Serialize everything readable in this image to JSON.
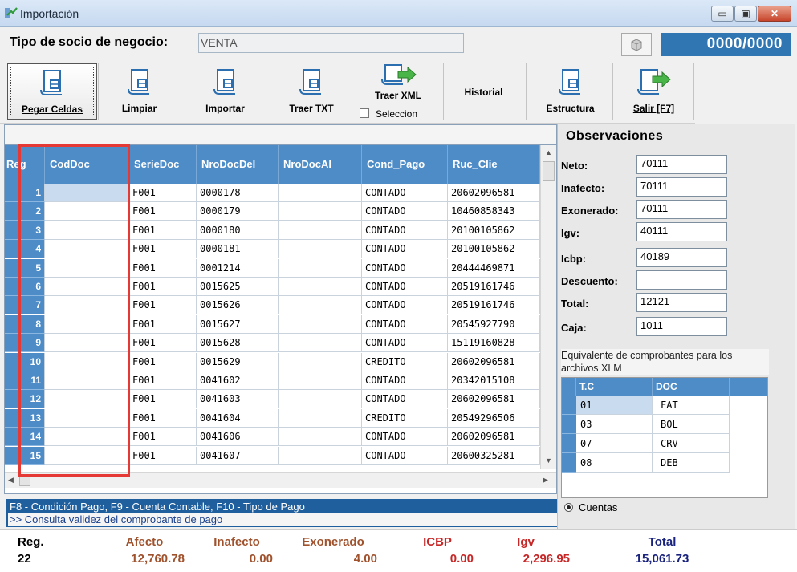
{
  "window": {
    "title": "Importación",
    "min_glyph": "▭",
    "max_glyph": "▣",
    "close_glyph": "✕"
  },
  "partner": {
    "label": "Tipo de socio de negocio:",
    "value": "VENTA",
    "counter": "0000/0000"
  },
  "toolbar": {
    "pegar": "Pegar Celdas",
    "limpiar": "Limpiar",
    "importar": "Importar",
    "traer_txt": "Traer TXT",
    "traer_xml": "Traer XML",
    "seleccion": "Seleccion",
    "historial": "Historial",
    "estructura": "Estructura",
    "salir": "Salir [F7]"
  },
  "grid": {
    "columns": [
      "Reg",
      "CodDoc",
      "SerieDoc",
      "NroDocDel",
      "NroDocAl",
      "Cond_Pago",
      "Ruc_Clie"
    ],
    "rows": [
      [
        "1",
        "",
        "F001",
        "0000178",
        "",
        "CONTADO",
        "20602096581"
      ],
      [
        "2",
        "",
        "F001",
        "0000179",
        "",
        "CONTADO",
        "10460858343"
      ],
      [
        "3",
        "",
        "F001",
        "0000180",
        "",
        "CONTADO",
        "20100105862"
      ],
      [
        "4",
        "",
        "F001",
        "0000181",
        "",
        "CONTADO",
        "20100105862"
      ],
      [
        "5",
        "",
        "F001",
        "0001214",
        "",
        "CONTADO",
        "20444469871"
      ],
      [
        "6",
        "",
        "F001",
        "0015625",
        "",
        "CONTADO",
        "20519161746"
      ],
      [
        "7",
        "",
        "F001",
        "0015626",
        "",
        "CONTADO",
        "20519161746"
      ],
      [
        "8",
        "",
        "F001",
        "0015627",
        "",
        "CONTADO",
        "20545927790"
      ],
      [
        "9",
        "",
        "F001",
        "0015628",
        "",
        "CONTADO",
        "15119160828"
      ],
      [
        "10",
        "",
        "F001",
        "0015629",
        "",
        "CREDITO",
        "20602096581"
      ],
      [
        "11",
        "",
        "F001",
        "0041602",
        "",
        "CONTADO",
        "20342015108"
      ],
      [
        "12",
        "",
        "F001",
        "0041603",
        "",
        "CONTADO",
        "20602096581"
      ],
      [
        "13",
        "",
        "F001",
        "0041604",
        "",
        "CREDITO",
        "20549296506"
      ],
      [
        "14",
        "",
        "F001",
        "0041606",
        "",
        "CONTADO",
        "20602096581"
      ],
      [
        "15",
        "",
        "F001",
        "0041607",
        "",
        "CONTADO",
        "20600325281"
      ]
    ]
  },
  "info": {
    "shortcuts": "F8 - Condición Pago,   F9 - Cuenta Contable,   F10 - Tipo de Pago",
    "consulta": ">> Consulta validez del comprobante de pago"
  },
  "observaciones": {
    "title": "Observaciones",
    "fields": [
      {
        "label": "Neto:",
        "value": "70111"
      },
      {
        "label": "Inafecto:",
        "value": "70111"
      },
      {
        "label": "Exonerado:",
        "value": "70111"
      },
      {
        "label": "Igv:",
        "value": "40111"
      },
      {
        "label": "Icbp:",
        "value": "40189"
      },
      {
        "label": "Descuento:",
        "value": ""
      },
      {
        "label": "Total:",
        "value": "12121"
      },
      {
        "label": "Caja:",
        "value": "1011"
      }
    ],
    "equiv_text": "Equivalente de comprobantes para los archivos XLM",
    "map_columns": [
      "T.C",
      "DOC"
    ],
    "map_rows": [
      [
        "01",
        "FAT"
      ],
      [
        "03",
        "BOL"
      ],
      [
        "07",
        "CRV"
      ],
      [
        "08",
        "DEB"
      ]
    ],
    "radio_label": "Cuentas"
  },
  "totals": {
    "labels": [
      "Reg.",
      "Afecto",
      "Inafecto",
      "Exonerado",
      "ICBP",
      "Igv",
      "Total"
    ],
    "values": [
      "22",
      "12,760.78",
      "0.00",
      "4.00",
      "0.00",
      "2,296.95",
      "15,061.73"
    ],
    "colors": {
      "reg": "#000000",
      "amount": "#a0522d",
      "red": "#c62828",
      "total": "#1a237e"
    }
  }
}
